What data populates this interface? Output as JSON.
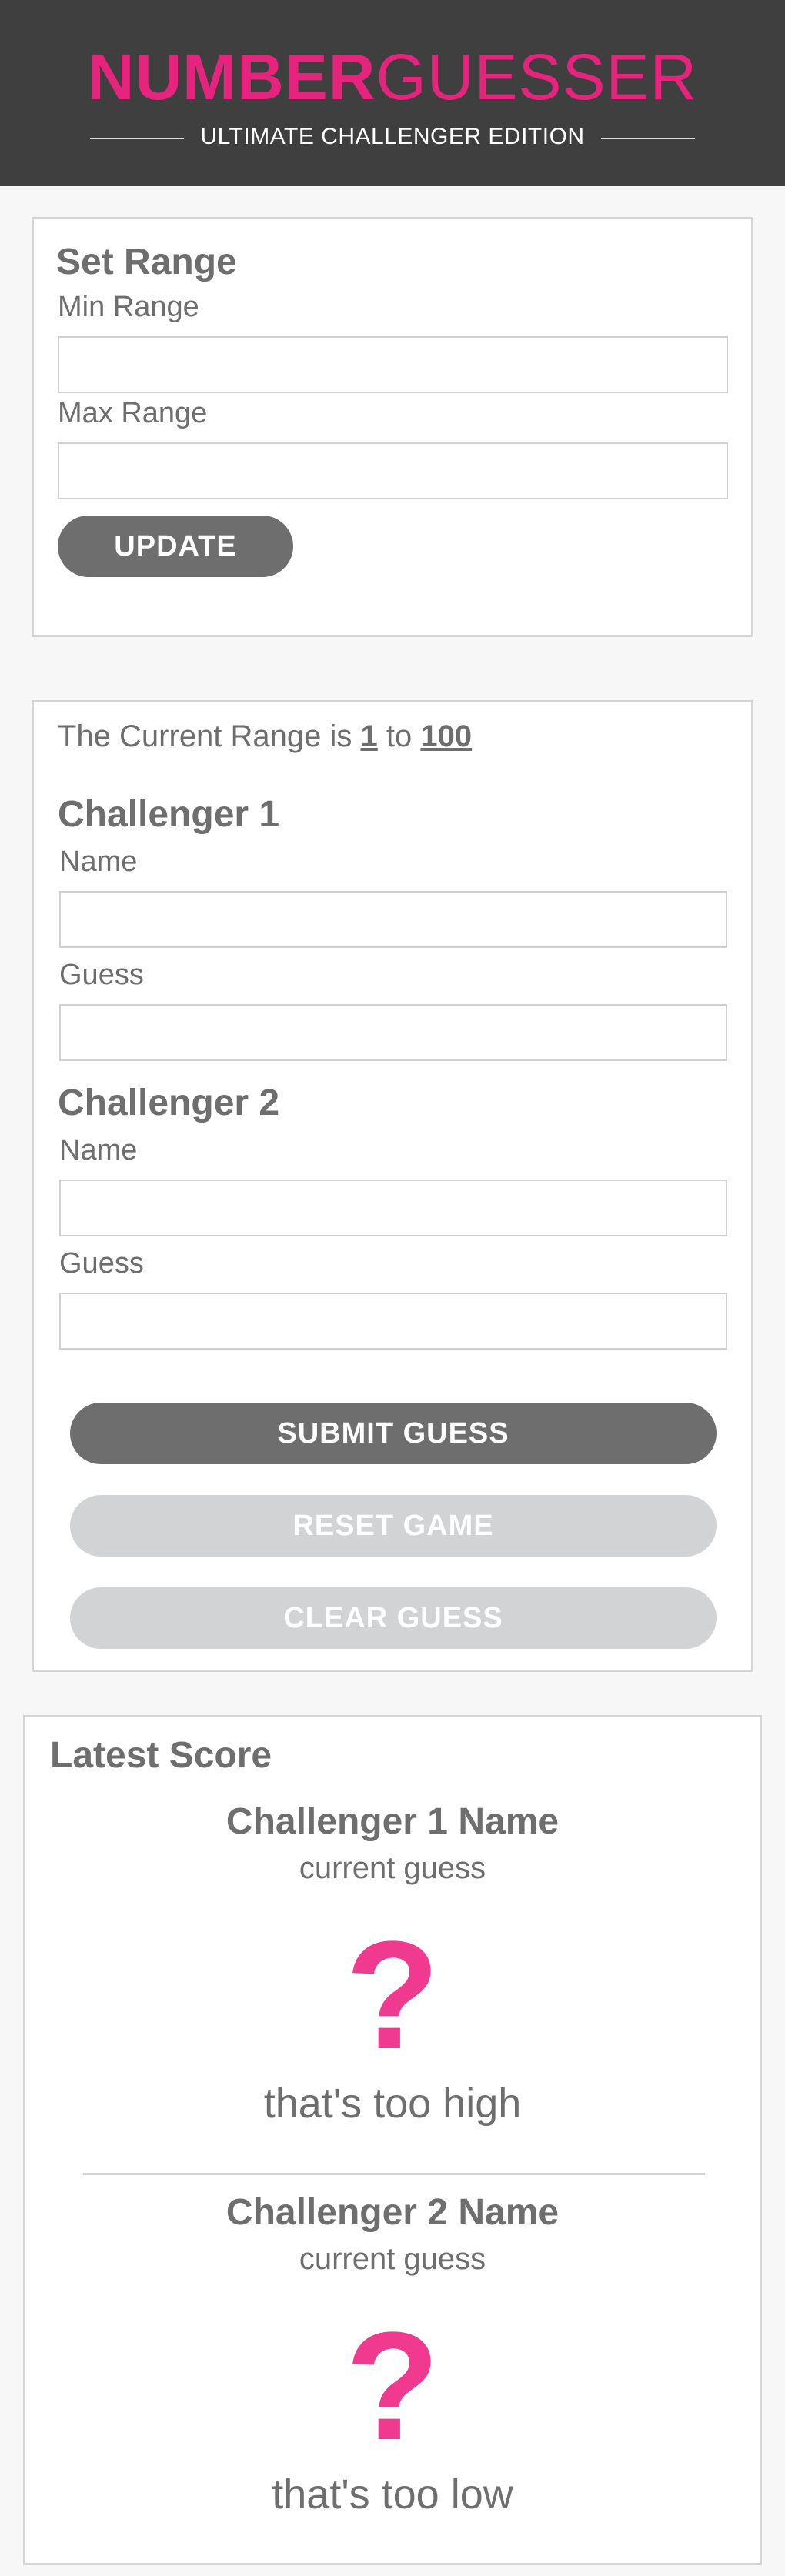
{
  "header": {
    "logo_bold": "NUMBER",
    "logo_light": "GUESSER",
    "subtitle": "ULTIMATE CHALLENGER EDITION"
  },
  "set_range": {
    "title": "Set Range",
    "min_label": "Min Range",
    "min_value": "",
    "max_label": "Max Range",
    "max_value": "",
    "update_label": "UPDATE"
  },
  "play": {
    "range_prefix": "The Current Range is",
    "range_min": "1",
    "range_to": "to",
    "range_max": "100",
    "challenger1": {
      "title": "Challenger 1",
      "name_label": "Name",
      "name_value": "",
      "guess_label": "Guess",
      "guess_value": ""
    },
    "challenger2": {
      "title": "Challenger 2",
      "name_label": "Name",
      "name_value": "",
      "guess_label": "Guess",
      "guess_value": ""
    },
    "submit_label": "SUBMIT GUESS",
    "reset_label": "RESET GAME",
    "clear_label": "CLEAR GUESS"
  },
  "score": {
    "title": "Latest Score",
    "entries": [
      {
        "name": "Challenger 1 Name",
        "sub": "current guess",
        "guess": "?",
        "message": "that's too high"
      },
      {
        "name": "Challenger 2 Name",
        "sub": "current guess",
        "guess": "?",
        "message": "that's too low"
      }
    ]
  },
  "colors": {
    "accent": "#e6247e",
    "header_bg": "#3f3f3f",
    "button_dark": "#6e6e6e",
    "button_disabled": "#d2d3d5",
    "guess_mark": "#ef3a8f"
  }
}
